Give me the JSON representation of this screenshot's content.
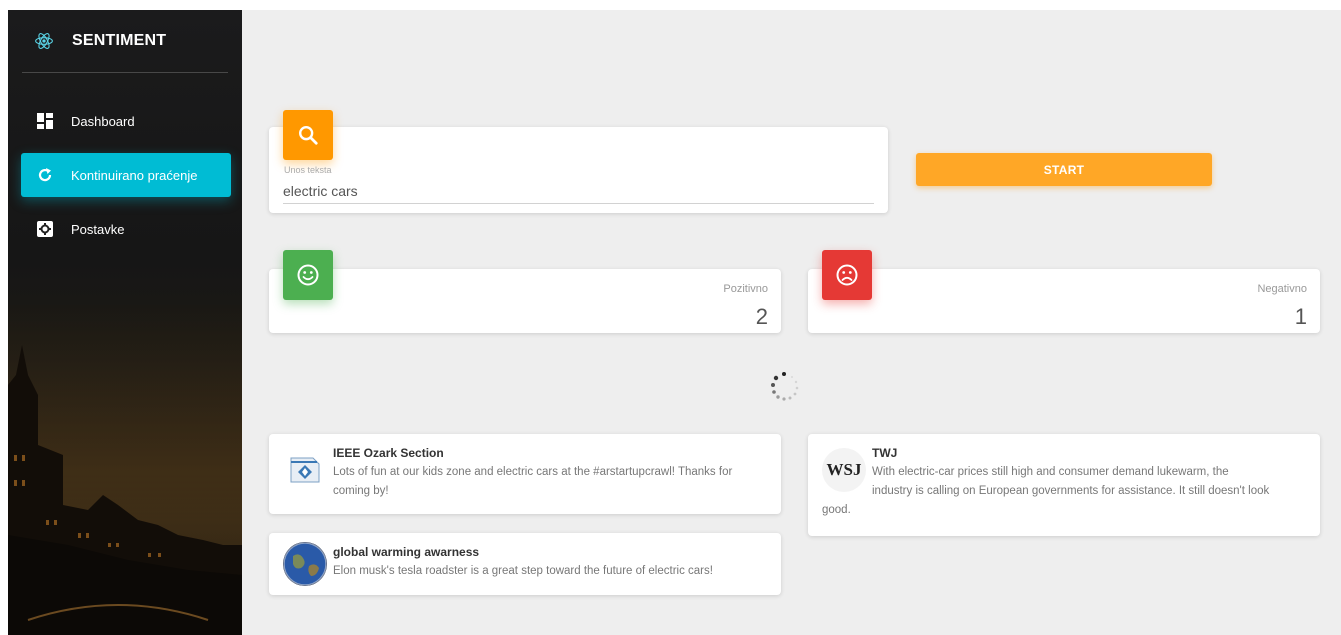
{
  "sidebar": {
    "brand": "SENTIMENT",
    "items": [
      {
        "label": "Dashboard",
        "icon": "dashboard-icon",
        "active": false
      },
      {
        "label": "Kontinuirano praćenje",
        "icon": "refresh-icon",
        "active": true
      },
      {
        "label": "Postavke",
        "icon": "settings-icon",
        "active": false
      }
    ]
  },
  "search": {
    "label": "Unos teksta",
    "value": "electric cars",
    "button": "START"
  },
  "stats": {
    "positive": {
      "label": "Pozitivno",
      "value": "2"
    },
    "negative": {
      "label": "Negativno",
      "value": "1"
    }
  },
  "tweets": [
    {
      "author": "IEEE Ozark Section",
      "text": "Lots of fun at our kids zone and electric cars at the #arstartupcrawl! Thanks for coming by!"
    },
    {
      "author": "TWJ",
      "avatar_text": "WSJ",
      "text_line1": "With electric-car prices still high and consumer demand lukewarm, the",
      "text_line2": "industry is calling on European governments for assistance. It still doesn't look",
      "text_line3": "good."
    },
    {
      "author": "global warming awarness",
      "text": "Elon musk's tesla roadster is a great step toward the future of electric cars!"
    }
  ],
  "colors": {
    "accent_cyan": "#00bcd4",
    "search_orange": "#ff9800",
    "start_orange": "#ffa726",
    "positive_green": "#4caf50",
    "negative_red": "#e53935"
  }
}
